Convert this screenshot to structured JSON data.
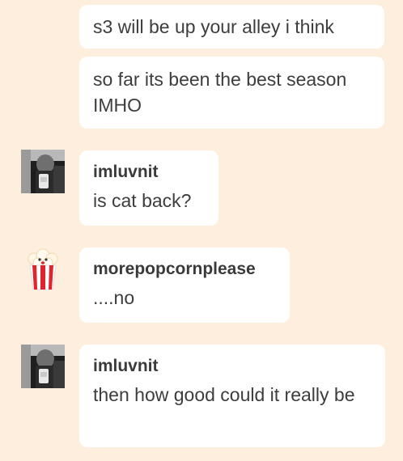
{
  "messages": [
    {
      "text": "s3 will be up your alley i think"
    },
    {
      "text": "so far its been the best season IMHO"
    },
    {
      "user": "imluvnit",
      "text": "is cat back?",
      "avatar": "user-photo-avatar"
    },
    {
      "user": "morepopcornplease",
      "text": "....no",
      "avatar": "popcorn-avatar"
    },
    {
      "user": "imluvnit",
      "text": "then how good could it really be",
      "avatar": "user-photo-avatar"
    }
  ],
  "colors": {
    "background": "#fdeedd",
    "bubble": "#ffffff",
    "text": "#3d3d3d",
    "popcorn_red": "#e0242c"
  }
}
